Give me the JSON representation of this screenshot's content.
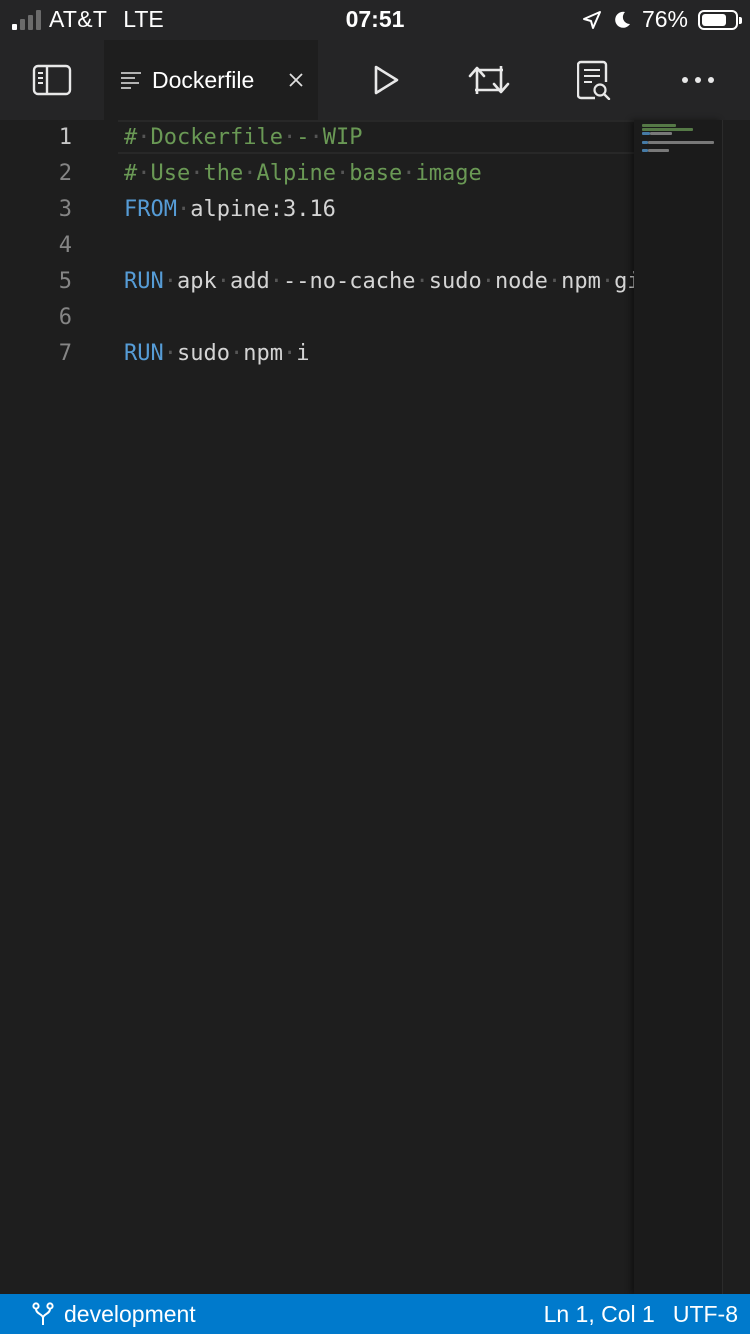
{
  "status_bar": {
    "carrier": "AT&T",
    "network": "LTE",
    "time": "07:51",
    "battery_percent": "76%",
    "battery_level": 0.76,
    "signal_bars_active": 1,
    "signal_bars_total": 4
  },
  "toolbar": {
    "tab_label": "Dockerfile",
    "icons": {
      "sidebar": "sidebar-toggle-icon",
      "file": "file-lines-icon",
      "close": "close-icon",
      "run": "play-icon",
      "swap": "swap-arrows-icon",
      "search": "document-search-icon",
      "more": "more-icon"
    }
  },
  "editor": {
    "current_line": 1,
    "lines": [
      {
        "number": "1",
        "tokens": [
          {
            "type": "comment",
            "text": "# Dockerfile - WIP"
          }
        ]
      },
      {
        "number": "2",
        "tokens": [
          {
            "type": "comment",
            "text": "# Use the Alpine base image"
          }
        ]
      },
      {
        "number": "3",
        "tokens": [
          {
            "type": "kw",
            "text": "FROM"
          },
          {
            "type": "plain",
            "text": " alpine:3.16"
          }
        ]
      },
      {
        "number": "4",
        "tokens": []
      },
      {
        "number": "5",
        "tokens": [
          {
            "type": "kw",
            "text": "RUN"
          },
          {
            "type": "plain",
            "text": " apk add --no-cache sudo node npm git"
          }
        ]
      },
      {
        "number": "6",
        "tokens": []
      },
      {
        "number": "7",
        "tokens": [
          {
            "type": "kw",
            "text": "RUN"
          },
          {
            "type": "plain",
            "text": " sudo npm i"
          }
        ]
      }
    ]
  },
  "footer": {
    "branch": "development",
    "cursor_position": "Ln 1, Col 1",
    "encoding": "UTF-8"
  },
  "colors": {
    "accent": "#007acc",
    "comment": "#6a9955",
    "keyword": "#569cd6",
    "background": "#1e1e1e",
    "chrome": "#252526"
  }
}
